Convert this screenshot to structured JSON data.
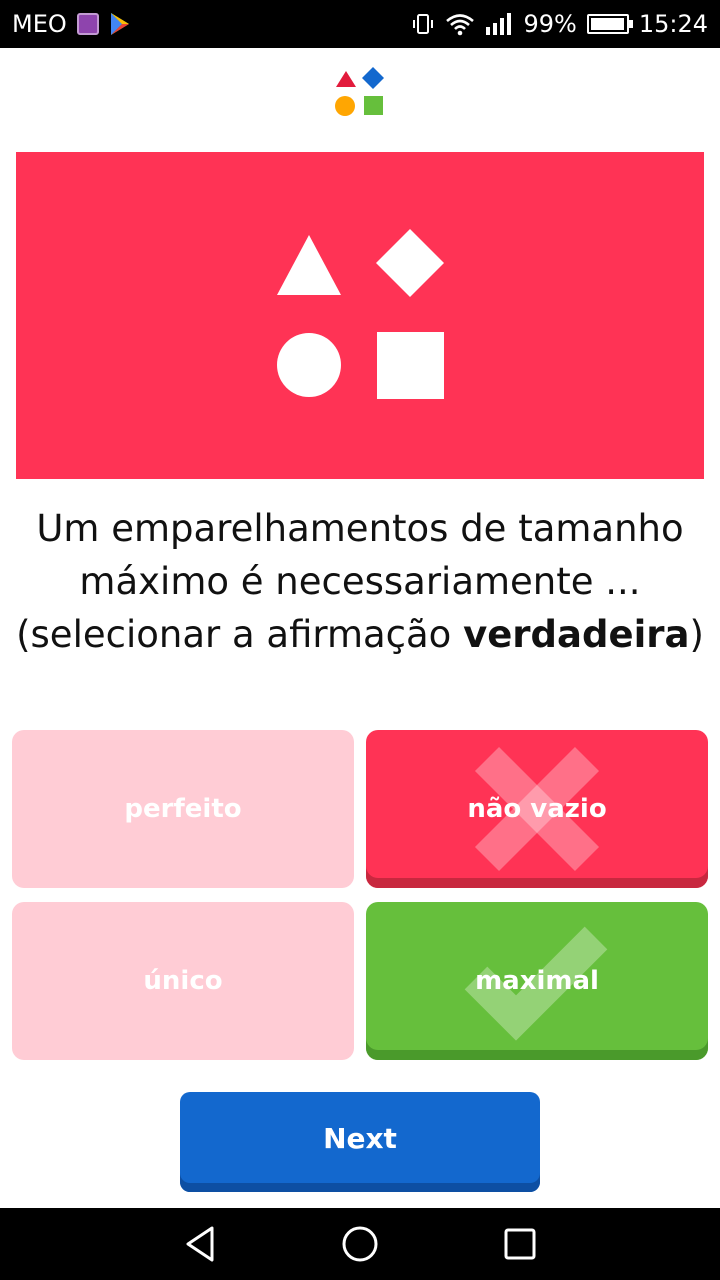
{
  "status_bar": {
    "carrier": "MEO",
    "battery_percent": "99%",
    "battery_level": 0.99,
    "time": "15:24",
    "icons": [
      "gallery-icon",
      "play-store-icon",
      "vibrate-icon",
      "wifi-icon",
      "signal-icon",
      "battery-icon"
    ]
  },
  "quiz": {
    "question_part1": "Um emparelhamentos de tamanho máximo é necessariamente ... (selecionar a afirmação ",
    "question_emphasis": "verdadeira",
    "question_part2": ")",
    "answers": [
      {
        "label": "perfeito",
        "state": "faded"
      },
      {
        "label": "não vazio",
        "state": "wrong-selected"
      },
      {
        "label": "único",
        "state": "faded"
      },
      {
        "label": "maximal",
        "state": "correct"
      }
    ],
    "next_label": "Next"
  },
  "colors": {
    "hero": "#ff3355",
    "wrong": "#ff3355",
    "faded": "#ffccd5",
    "correct": "#66bf3c",
    "next": "#1368ce",
    "logo_triangle": "#e21b3c",
    "logo_diamond": "#1368ce",
    "logo_circle": "#ffa602",
    "logo_square": "#66bf3c"
  },
  "nav_bar": {
    "icons": [
      "back-icon",
      "home-icon",
      "recents-icon"
    ]
  }
}
